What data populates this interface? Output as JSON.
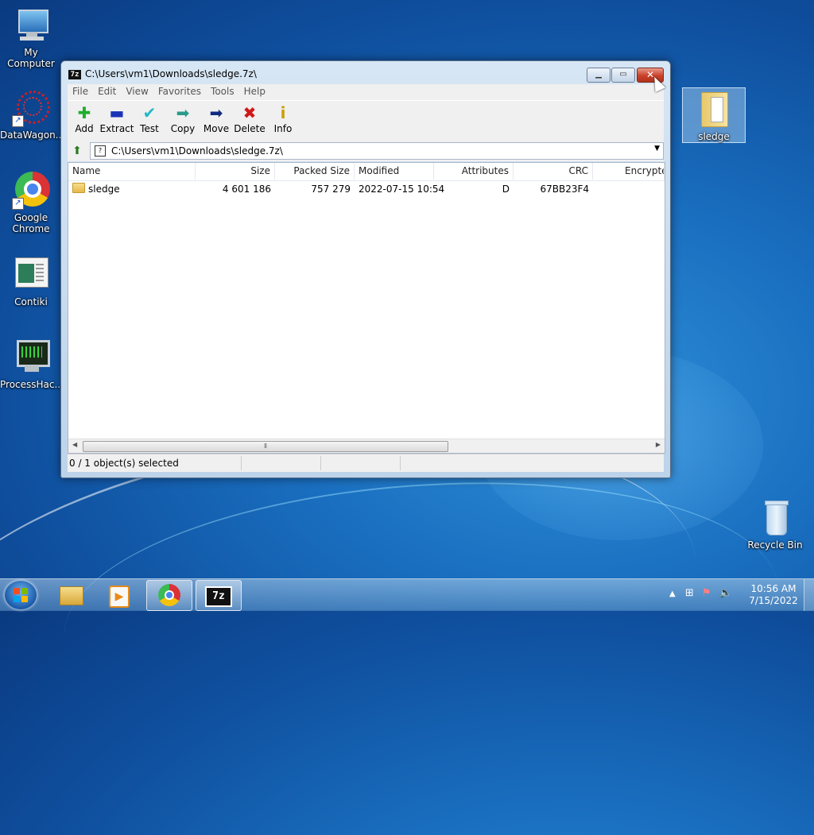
{
  "desktop": {
    "icons": [
      {
        "label": "My Computer",
        "icon": "computer-icon"
      },
      {
        "label": "DataWagon...",
        "icon": "datawagon-icon"
      },
      {
        "label": "Google Chrome",
        "icon": "chrome-icon"
      },
      {
        "label": "Contiki",
        "icon": "contiki-icon"
      },
      {
        "label": "ProcessHac...",
        "icon": "processhacker-icon"
      },
      {
        "label": "sledge",
        "icon": "folder-icon"
      },
      {
        "label": "Recycle Bin",
        "icon": "recycle-bin-icon"
      }
    ]
  },
  "window": {
    "title": "C:\\Users\\vm1\\Downloads\\sledge.7z\\",
    "app_icon_text": "7z",
    "menu": [
      "File",
      "Edit",
      "View",
      "Favorites",
      "Tools",
      "Help"
    ],
    "toolbar": [
      {
        "label": "Add",
        "icon": "add-icon",
        "glyph": "✚",
        "color": "#1fae2a"
      },
      {
        "label": "Extract",
        "icon": "extract-icon",
        "glyph": "▬",
        "color": "#1a33b8"
      },
      {
        "label": "Test",
        "icon": "test-icon",
        "glyph": "✔",
        "color": "#25b8c8"
      },
      {
        "label": "Copy",
        "icon": "copy-icon",
        "glyph": "➡",
        "color": "#2a9a8a"
      },
      {
        "label": "Move",
        "icon": "move-icon",
        "glyph": "➡",
        "color": "#102a80"
      },
      {
        "label": "Delete",
        "icon": "delete-icon",
        "glyph": "✖",
        "color": "#d01818"
      },
      {
        "label": "Info",
        "icon": "info-icon",
        "glyph": "i",
        "color": "#c8a000"
      }
    ],
    "address": "C:\\Users\\vm1\\Downloads\\sledge.7z\\",
    "columns": [
      "Name",
      "Size",
      "Packed Size",
      "Modified",
      "Attributes",
      "CRC",
      "Encrypte"
    ],
    "rows": [
      {
        "name": "sledge",
        "size": "4 601 186",
        "packed_size": "757 279",
        "modified": "2022-07-15 10:54",
        "attributes": "D",
        "crc": "67BB23F4",
        "encrypted": ""
      }
    ],
    "status": "0 / 1 object(s) selected"
  },
  "taskbar": {
    "clock_time": "10:56 AM",
    "clock_date": "7/15/2022"
  },
  "colors": {
    "accent": "#1a6fc0",
    "close_button": "#c9412a"
  }
}
